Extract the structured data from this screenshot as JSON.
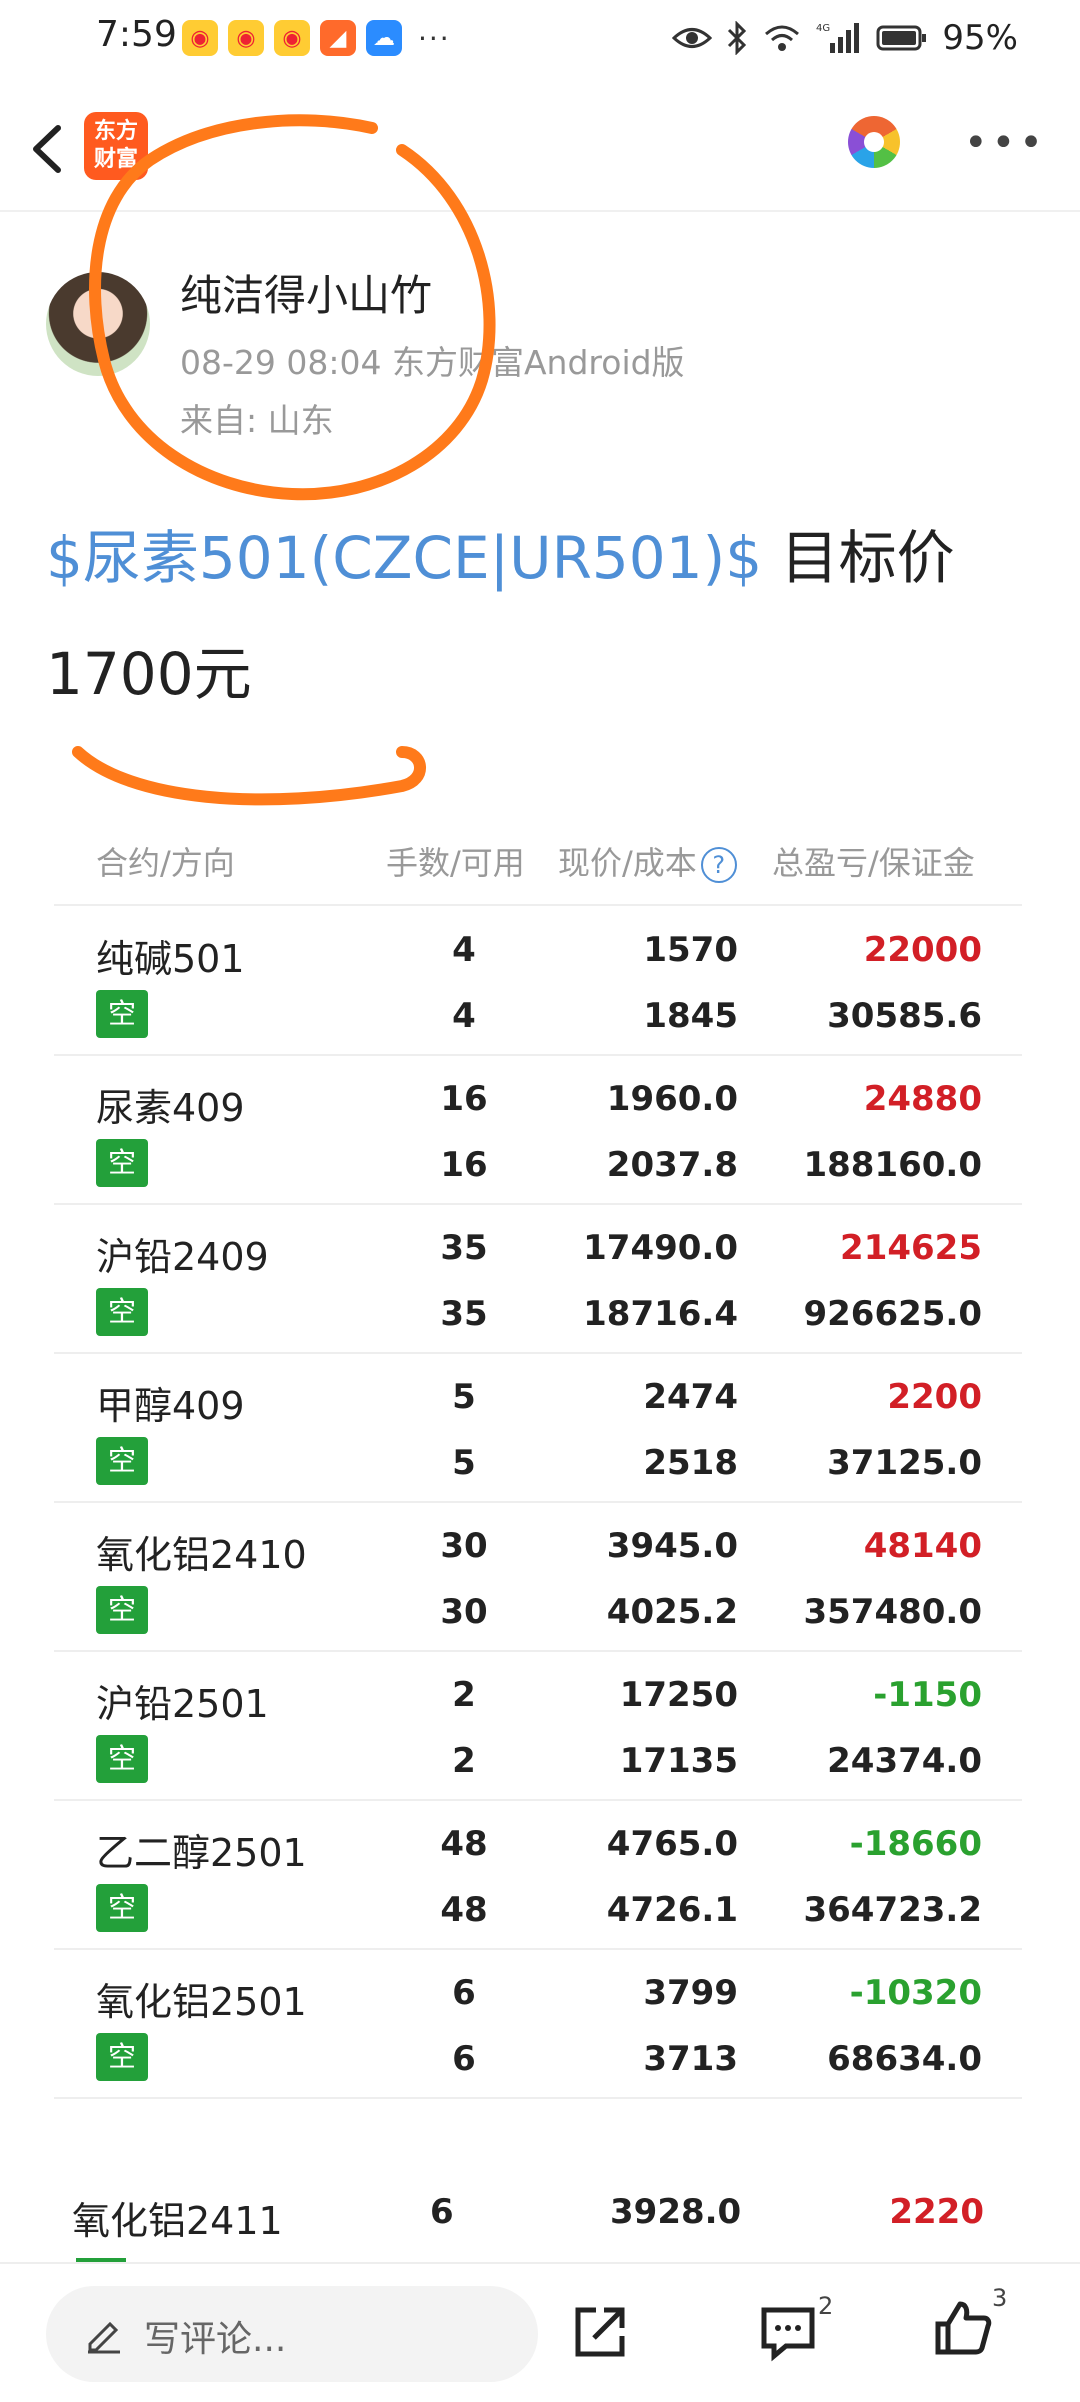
{
  "status_bar": {
    "time": "7:59",
    "battery": "95%",
    "network": "4G"
  },
  "header": {
    "logo_line1": "东方",
    "logo_line2": "财富"
  },
  "author": {
    "name": "纯洁得小山竹",
    "meta": "08-29 08:04 东方财富Android版",
    "from": "来自: 山东"
  },
  "post": {
    "stock_link": "$尿素501(CZCE|UR501)$",
    "text": " 目标价1700元"
  },
  "table": {
    "headers": {
      "contract": "合约/方向",
      "qty": "手数/可用",
      "price": "现价/成本",
      "pl": "总盈亏/保证金"
    },
    "rows": [
      {
        "name": "纯碱501",
        "dir": "空",
        "qty": "4",
        "avail": "4",
        "price": "1570",
        "cost": "1845",
        "pl": "22000",
        "margin": "30585.6"
      },
      {
        "name": "尿素409",
        "dir": "空",
        "qty": "16",
        "avail": "16",
        "price": "1960.0",
        "cost": "2037.8",
        "pl": "24880",
        "margin": "188160.0"
      },
      {
        "name": "沪铅2409",
        "dir": "空",
        "qty": "35",
        "avail": "35",
        "price": "17490.0",
        "cost": "18716.4",
        "pl": "214625",
        "margin": "926625.0"
      },
      {
        "name": "甲醇409",
        "dir": "空",
        "qty": "5",
        "avail": "5",
        "price": "2474",
        "cost": "2518",
        "pl": "2200",
        "margin": "37125.0"
      },
      {
        "name": "氧化铝2410",
        "dir": "空",
        "qty": "30",
        "avail": "30",
        "price": "3945.0",
        "cost": "4025.2",
        "pl": "48140",
        "margin": "357480.0"
      },
      {
        "name": "沪铅2501",
        "dir": "空",
        "qty": "2",
        "avail": "2",
        "price": "17250",
        "cost": "17135",
        "pl": "-1150",
        "margin": "24374.0"
      },
      {
        "name": "乙二醇2501",
        "dir": "空",
        "qty": "48",
        "avail": "48",
        "price": "4765.0",
        "cost": "4726.1",
        "pl": "-18660",
        "margin": "364723.2"
      },
      {
        "name": "氧化铝2501",
        "dir": "空",
        "qty": "6",
        "avail": "6",
        "price": "3799",
        "cost": "3713",
        "pl": "-10320",
        "margin": "68634.0"
      }
    ],
    "extra_row": {
      "name": "氧化铝2411",
      "qty": "6",
      "price": "3928.0",
      "pl": "2220"
    }
  },
  "bottom_bar": {
    "comment_placeholder": "写评论...",
    "comment_count": "2",
    "like_count": "3"
  },
  "colors": {
    "profit": "#d21f26",
    "loss": "#2aa12f",
    "link": "#4f8fd6",
    "brand": "#ff5a1f",
    "annotation": "#ff7a1a"
  }
}
